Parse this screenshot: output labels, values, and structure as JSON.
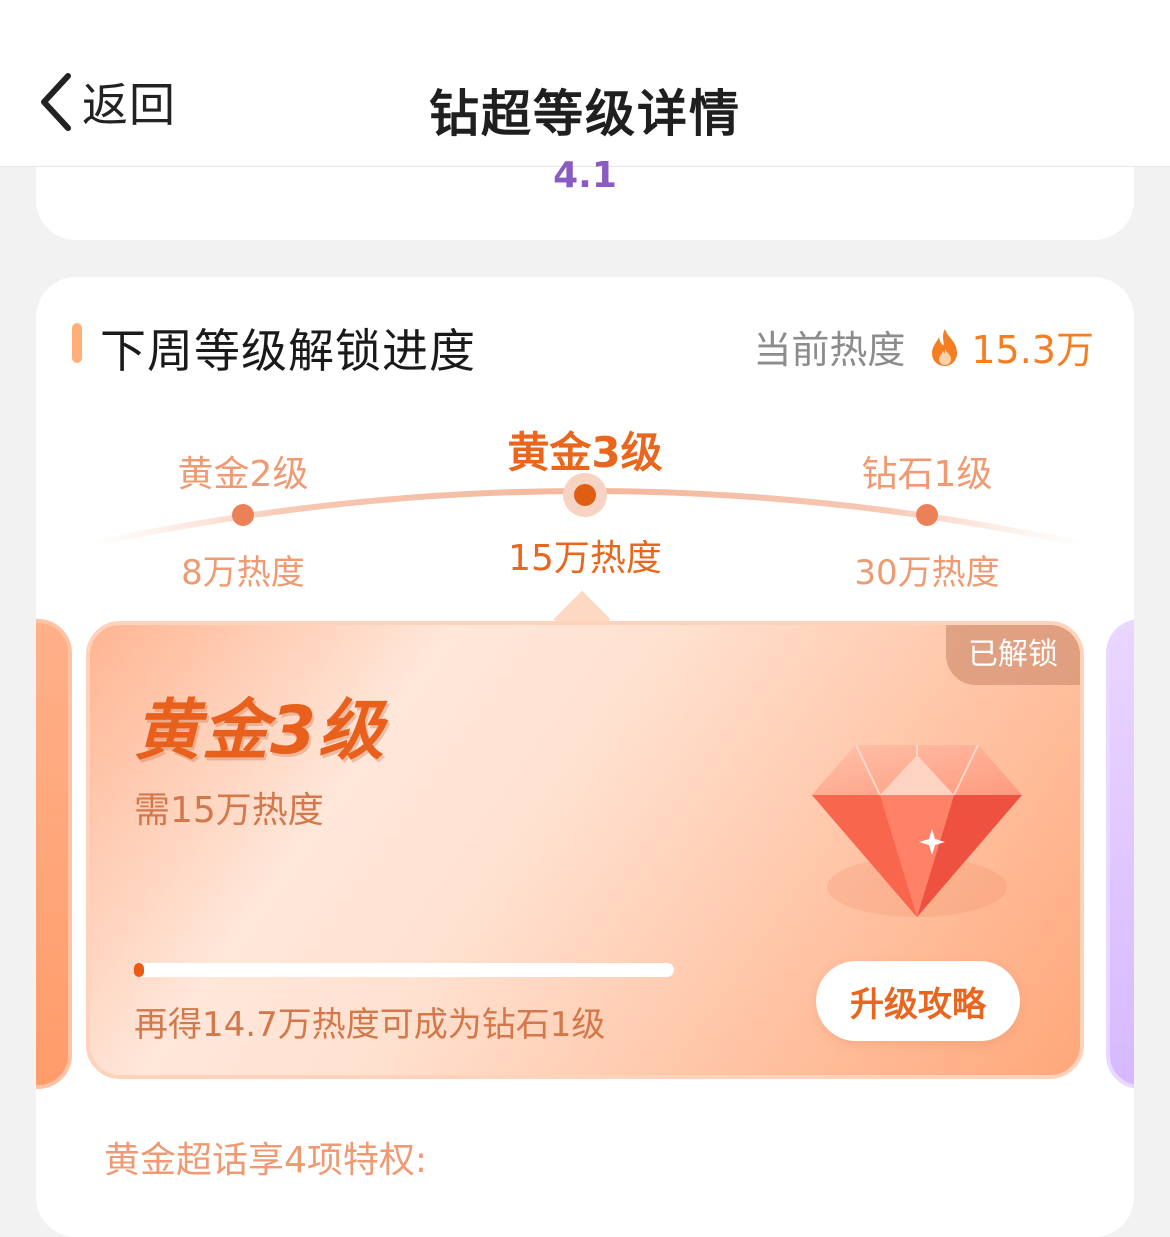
{
  "nav": {
    "back_label": "返回",
    "title": "钻超等级详情"
  },
  "top_card": {
    "value": "4.1"
  },
  "section": {
    "title": "下周等级解锁进度",
    "current_heat_label": "当前热度",
    "current_heat_value": "15.3万",
    "heat_icon": "flame-icon"
  },
  "levels": [
    {
      "name": "黄金2级",
      "requirement": "8万热度",
      "active": false
    },
    {
      "name": "黄金3级",
      "requirement": "15万热度",
      "active": true
    },
    {
      "name": "钻石1级",
      "requirement": "30万热度",
      "active": false
    }
  ],
  "card": {
    "status_tag": "已解锁",
    "level_name": "黄金3级",
    "requirement": "需15万热度",
    "progress_fraction": 0.015,
    "progress_text": "再得14.7万热度可成为钻石1级",
    "upgrade_button": "升级攻略",
    "gem_icon": "diamond-gem-icon"
  },
  "privilege_heading": "黄金超话享4项特权:",
  "colors": {
    "accent": "#e8661e",
    "accent_light": "#ef9a72",
    "heat": "#f57d22",
    "top_value": "#8a5cc2"
  }
}
